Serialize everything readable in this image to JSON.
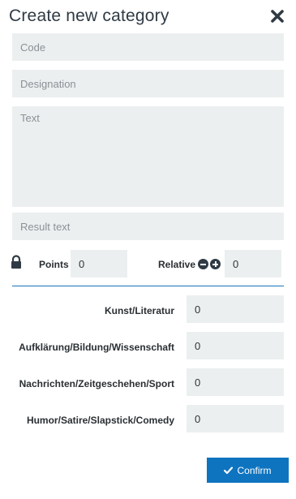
{
  "dialog": {
    "title": "Create new category"
  },
  "fields": {
    "code_placeholder": "Code",
    "designation_placeholder": "Designation",
    "text_placeholder": "Text",
    "result_placeholder": "Result text"
  },
  "scoring": {
    "points_label": "Points",
    "points_value": "0",
    "relative_label": "Relative",
    "relative_value": "0"
  },
  "categories": [
    {
      "label": "Kunst/Literatur",
      "value": "0"
    },
    {
      "label": "Aufklärung/Bildung/Wissenschaft",
      "value": "0"
    },
    {
      "label": "Nachrichten/Zeitgeschehen/Sport",
      "value": "0"
    },
    {
      "label": "Humor/Satire/Slapstick/Comedy",
      "value": "0"
    }
  ],
  "actions": {
    "confirm_label": "Confirm"
  },
  "colors": {
    "accent": "#0e74c0",
    "field_bg": "#eceff0",
    "divider": "#1a73b8"
  },
  "icons": {
    "close": "close-icon",
    "lock": "lock-icon",
    "minus": "minus-circle-icon",
    "plus": "plus-circle-icon",
    "check": "check-icon"
  }
}
